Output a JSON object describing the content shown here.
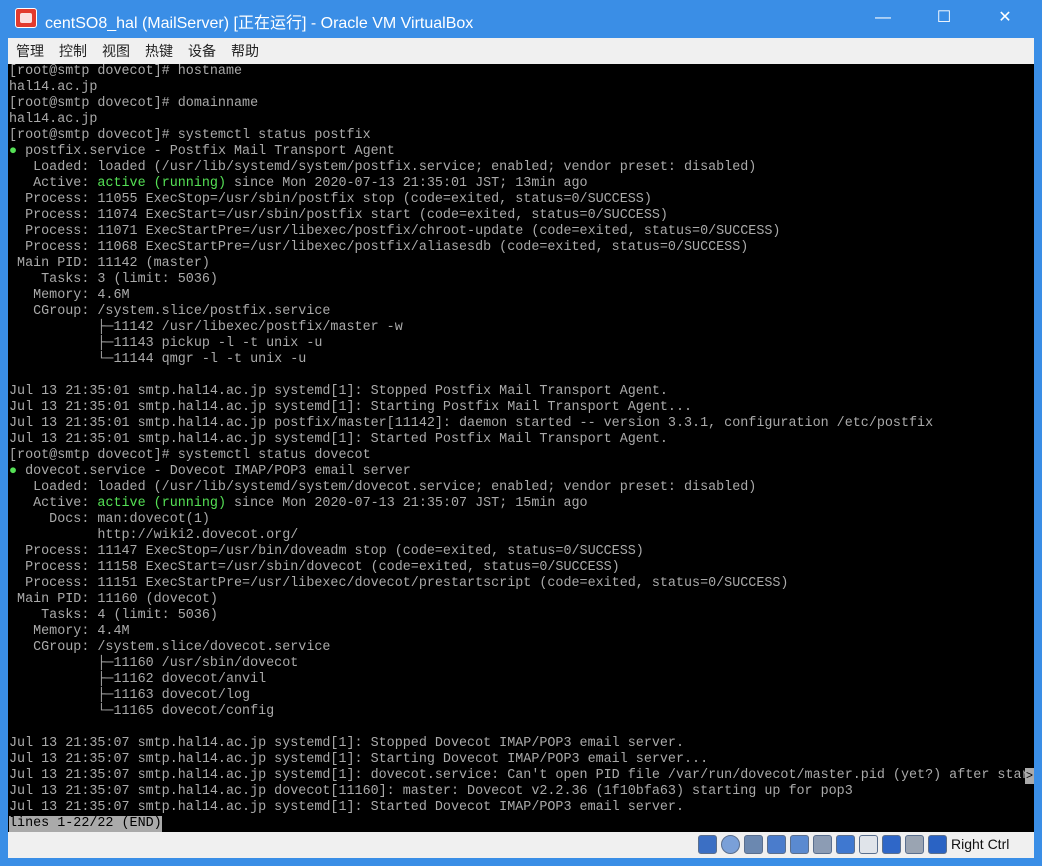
{
  "window": {
    "title": "centSO8_hal (MailServer) [正在运行] - Oracle VM VirtualBox",
    "minimize_glyph": "—",
    "maximize_glyph": "☐",
    "close_glyph": "✕"
  },
  "menu": [
    "管理",
    "控制",
    "视图",
    "热键",
    "设备",
    "帮助"
  ],
  "terminal": {
    "lines": [
      {
        "text": "[root@smtp dovecot]# hostname"
      },
      {
        "text": "hal14.ac.jp"
      },
      {
        "text": "[root@smtp dovecot]# domainname"
      },
      {
        "text": "hal14.ac.jp"
      },
      {
        "text": "[root@smtp dovecot]# systemctl status postfix"
      },
      {
        "bullet": "●",
        "text": " postfix.service - Postfix Mail Transport Agent"
      },
      {
        "text": "   Loaded: loaded (/usr/lib/systemd/system/postfix.service; enabled; vendor preset: disabled)"
      },
      {
        "pre": "   Active: ",
        "active": "active (running)",
        "text": " since Mon 2020-07-13 21:35:01 JST; 13min ago"
      },
      {
        "text": "  Process: 11055 ExecStop=/usr/sbin/postfix stop (code=exited, status=0/SUCCESS)"
      },
      {
        "text": "  Process: 11074 ExecStart=/usr/sbin/postfix start (code=exited, status=0/SUCCESS)"
      },
      {
        "text": "  Process: 11071 ExecStartPre=/usr/libexec/postfix/chroot-update (code=exited, status=0/SUCCESS)"
      },
      {
        "text": "  Process: 11068 ExecStartPre=/usr/libexec/postfix/aliasesdb (code=exited, status=0/SUCCESS)"
      },
      {
        "text": " Main PID: 11142 (master)"
      },
      {
        "text": "    Tasks: 3 (limit: 5036)"
      },
      {
        "text": "   Memory: 4.6M"
      },
      {
        "text": "   CGroup: /system.slice/postfix.service"
      },
      {
        "text": "           ├─11142 /usr/libexec/postfix/master -w"
      },
      {
        "text": "           ├─11143 pickup -l -t unix -u"
      },
      {
        "text": "           └─11144 qmgr -l -t unix -u"
      },
      {
        "text": ""
      },
      {
        "text": "Jul 13 21:35:01 smtp.hal14.ac.jp systemd[1]: Stopped Postfix Mail Transport Agent."
      },
      {
        "text": "Jul 13 21:35:01 smtp.hal14.ac.jp systemd[1]: Starting Postfix Mail Transport Agent..."
      },
      {
        "text": "Jul 13 21:35:01 smtp.hal14.ac.jp postfix/master[11142]: daemon started -- version 3.3.1, configuration /etc/postfix"
      },
      {
        "text": "Jul 13 21:35:01 smtp.hal14.ac.jp systemd[1]: Started Postfix Mail Transport Agent."
      },
      {
        "text": "[root@smtp dovecot]# systemctl status dovecot"
      },
      {
        "bullet": "●",
        "text": " dovecot.service - Dovecot IMAP/POP3 email server"
      },
      {
        "text": "   Loaded: loaded (/usr/lib/systemd/system/dovecot.service; enabled; vendor preset: disabled)"
      },
      {
        "pre": "   Active: ",
        "active": "active (running)",
        "text": " since Mon 2020-07-13 21:35:07 JST; 15min ago"
      },
      {
        "text": "     Docs: man:dovecot(1)"
      },
      {
        "text": "           http://wiki2.dovecot.org/"
      },
      {
        "text": "  Process: 11147 ExecStop=/usr/bin/doveadm stop (code=exited, status=0/SUCCESS)"
      },
      {
        "text": "  Process: 11158 ExecStart=/usr/sbin/dovecot (code=exited, status=0/SUCCESS)"
      },
      {
        "text": "  Process: 11151 ExecStartPre=/usr/libexec/dovecot/prestartscript (code=exited, status=0/SUCCESS)"
      },
      {
        "text": " Main PID: 11160 (dovecot)"
      },
      {
        "text": "    Tasks: 4 (limit: 5036)"
      },
      {
        "text": "   Memory: 4.4M"
      },
      {
        "text": "   CGroup: /system.slice/dovecot.service"
      },
      {
        "text": "           ├─11160 /usr/sbin/dovecot"
      },
      {
        "text": "           ├─11162 dovecot/anvil"
      },
      {
        "text": "           ├─11163 dovecot/log"
      },
      {
        "text": "           └─11165 dovecot/config"
      },
      {
        "text": ""
      },
      {
        "text": "Jul 13 21:35:07 smtp.hal14.ac.jp systemd[1]: Stopped Dovecot IMAP/POP3 email server."
      },
      {
        "text": "Jul 13 21:35:07 smtp.hal14.ac.jp systemd[1]: Starting Dovecot IMAP/POP3 email server..."
      },
      {
        "text": "Jul 13 21:35:07 smtp.hal14.ac.jp systemd[1]: dovecot.service: Can't open PID file /var/run/dovecot/master.pid (yet?) after star",
        "truncated": true
      },
      {
        "text": "Jul 13 21:35:07 smtp.hal14.ac.jp dovecot[11160]: master: Dovecot v2.2.36 (1f10bfa63) starting up for pop3"
      },
      {
        "text": "Jul 13 21:35:07 smtp.hal14.ac.jp systemd[1]: Started Dovecot IMAP/POP3 email server."
      }
    ],
    "pager": "lines 1-22/22 (END)",
    "truncation_glyph": ">",
    "active_color": "#55e055"
  },
  "statusbar": {
    "icons": [
      "hard-disk-icon",
      "optical-drive-icon",
      "audio-icon",
      "network-icon",
      "usb-icon",
      "shared-folders-icon",
      "display-icon",
      "video-capture-icon",
      "virtualization-icon",
      "mouse-integration-icon",
      "keyboard-icon"
    ],
    "host_key": "Right Ctrl"
  }
}
